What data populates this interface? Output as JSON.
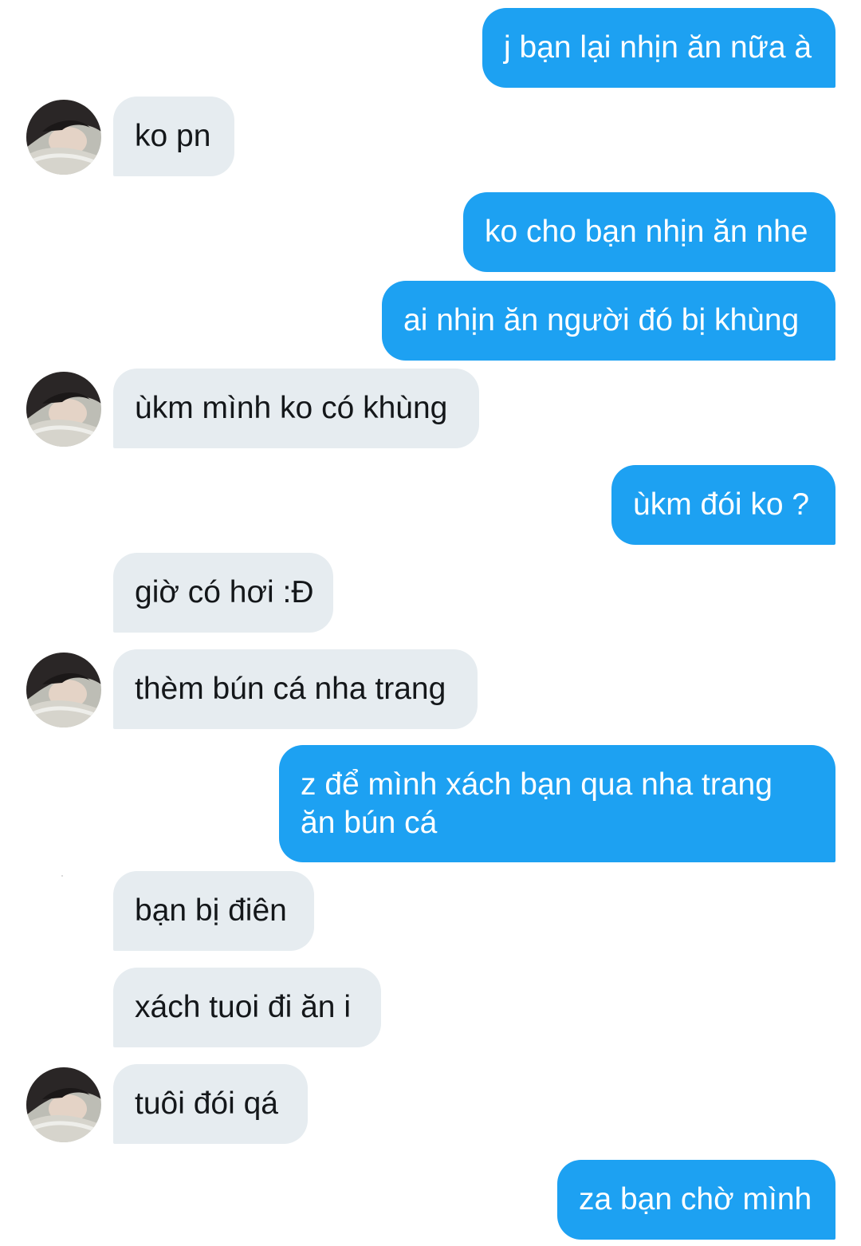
{
  "conversation": {
    "messages": [
      {
        "direction": "outgoing",
        "text": "j bạn lại nhịn ăn nữa à"
      },
      {
        "direction": "incoming",
        "text": "ko pn",
        "avatar": true
      },
      {
        "direction": "outgoing",
        "text": "ko cho bạn nhịn ăn nhe"
      },
      {
        "direction": "outgoing",
        "text": "ai nhịn ăn người đó bị khùng"
      },
      {
        "direction": "incoming",
        "text": "ùkm mình ko có khùng",
        "avatar": true
      },
      {
        "direction": "outgoing",
        "text": "ùkm đói ko ?"
      },
      {
        "direction": "incoming",
        "text": "giờ có hơi :Đ",
        "avatar": false
      },
      {
        "direction": "incoming",
        "text": "thèm bún cá nha trang",
        "avatar": true
      },
      {
        "direction": "outgoing",
        "text": "z để mình xách bạn qua nha trang ăn bún cá"
      },
      {
        "direction": "incoming",
        "text": "bạn bị điên",
        "avatar": false
      },
      {
        "direction": "incoming",
        "text": "xách tuoi đi ăn i",
        "avatar": false
      },
      {
        "direction": "incoming",
        "text": "tuôi đói qá",
        "avatar": true
      },
      {
        "direction": "outgoing",
        "text": "za bạn chờ mình"
      }
    ]
  },
  "avatar_icon": "user-avatar-photo",
  "colors": {
    "outgoing_bubble": "#1da1f2",
    "outgoing_text": "#ffffff",
    "incoming_bubble": "#e6ecf0",
    "incoming_text": "#14171a",
    "background": "#ffffff"
  }
}
